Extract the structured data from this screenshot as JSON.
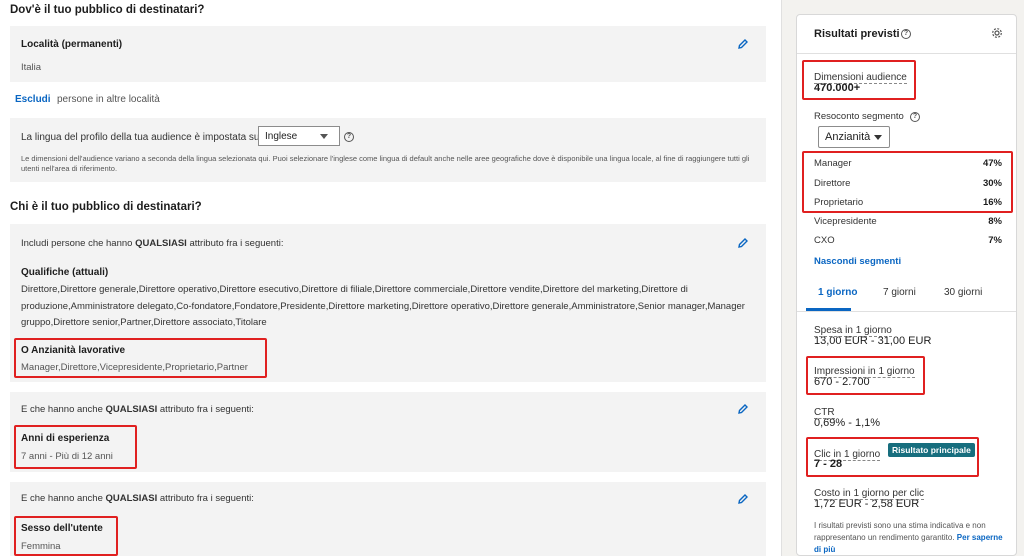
{
  "where": {
    "heading": "Dov'è il tuo pubblico di destinatari?",
    "location_label": "Località (permanenti)",
    "location_value": "Italia",
    "exclude_link": "Escludi",
    "exclude_rest": "persone in altre località",
    "language_text": "La lingua del profilo della tua audience è impostata su",
    "language_value": "Inglese",
    "language_note": "Le dimensioni dell'audience variano a seconda della lingua selezionata qui. Puoi selezionare l'inglese come lingua di default anche nelle aree geografiche dove è disponibile una lingua locale, al fine di raggiungere tutti gli utenti nell'area di riferimento."
  },
  "who": {
    "heading": "Chi è il tuo pubblico di destinatari?",
    "include_prefix": "Includi persone che hanno",
    "include_bold": "QUALSIASI",
    "include_suffix": "attributo fra i seguenti:",
    "titles_label": "Qualifiche (attuali)",
    "titles_value": "Direttore,Direttore generale,Direttore operativo,Direttore esecutivo,Direttore di filiale,Direttore commerciale,Direttore vendite,Direttore del marketing,Direttore di produzione,Amministratore delegato,Co-fondatore,Fondatore,Presidente,Direttore marketing,Direttore operativo,Direttore generale,Amministratore,Senior manager,Manager gruppo,Direttore senior,Partner,Direttore associato,Titolare",
    "seniority_label": "O Anzianità lavorative",
    "seniority_value": "Manager,Direttore,Vicepresidente,Proprietario,Partner",
    "and_prefix": "E che hanno anche",
    "and_bold": "QUALSIASI",
    "and_suffix": "attributo fra i seguenti:",
    "experience_label": "Anni di esperienza",
    "experience_value": "7 anni - Più di 12 anni",
    "gender_label": "Sesso dell'utente",
    "gender_value": "Femmina"
  },
  "results": {
    "title": "Risultati previsti",
    "audience_label": "Dimensioni audience",
    "audience_value": "470.000+",
    "segment_label": "Resoconto segmento",
    "segment_dropdown": "Anzianità",
    "segments": [
      {
        "name": "Manager",
        "pct": "47%"
      },
      {
        "name": "Direttore",
        "pct": "30%"
      },
      {
        "name": "Proprietario",
        "pct": "16%"
      },
      {
        "name": "Vicepresidente",
        "pct": "8%"
      },
      {
        "name": "CXO",
        "pct": "7%"
      }
    ],
    "hide_segments": "Nascondi segmenti",
    "tabs": [
      "1 giorno",
      "7 giorni",
      "30 giorni"
    ],
    "spend_label": "Spesa in 1 giorno",
    "spend_value": "13,00 EUR - 31,00 EUR",
    "impressions_label": "Impressioni in 1 giorno",
    "impressions_value": "670 - 2.700",
    "ctr_label": "CTR",
    "ctr_value": "0,69% - 1,1%",
    "clicks_label": "Clic in 1 giorno",
    "clicks_badge": "Risultato principale",
    "clicks_value": "7 - 28",
    "cpc_label": "Costo in 1 giorno per clic",
    "cpc_value": "1,72 EUR - 2,58 EUR",
    "footnote": "I risultati previsti sono una stima indicativa e non rappresentano un rendimento garantito.",
    "footnote_link": "Per saperne di più"
  },
  "colors": {
    "accent": "#0a66c2",
    "highlight": "#e02020",
    "badge": "#176e7e"
  }
}
